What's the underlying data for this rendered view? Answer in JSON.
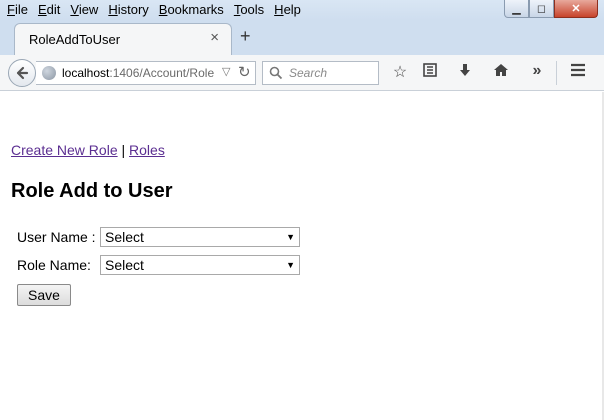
{
  "menu": [
    {
      "accel": "F",
      "rest": "ile"
    },
    {
      "accel": "E",
      "rest": "dit"
    },
    {
      "accel": "V",
      "rest": "iew"
    },
    {
      "accel": "H",
      "rest": "istory"
    },
    {
      "accel": "B",
      "rest": "ookmarks"
    },
    {
      "accel": "T",
      "rest": "ools"
    },
    {
      "accel": "H",
      "rest": "elp"
    }
  ],
  "window": {
    "minimize": "▁",
    "maximize": "◻",
    "close": "✕"
  },
  "tab": {
    "title": "RoleAddToUser",
    "close": "×",
    "new_tab": "+"
  },
  "nav": {
    "url_host": "localhost",
    "url_rest": ":1406/Account/Role",
    "search_placeholder": "Search"
  },
  "icons": {
    "back": "back-arrow-icon",
    "globe": "globe-icon",
    "reload": "reload-icon",
    "search": "search-icon",
    "bookmark_star": "star-icon",
    "reading_list": "reading-list-icon",
    "downloads": "download-icon",
    "home": "home-icon",
    "overflow": "chevron-double-right-icon",
    "menu": "hamburger-menu-icon"
  },
  "page": {
    "link_create": "Create New Role",
    "link_separator": "|",
    "link_roles": "Roles",
    "title": "Role Add to User",
    "user_label": "User Name :",
    "user_select": "Select",
    "role_label": "Role Name:",
    "role_select": "Select",
    "save_label": "Save"
  },
  "colors": {
    "link": "#5b2e91",
    "chrome": "#cfdeef",
    "close_button": "#c7432b"
  }
}
